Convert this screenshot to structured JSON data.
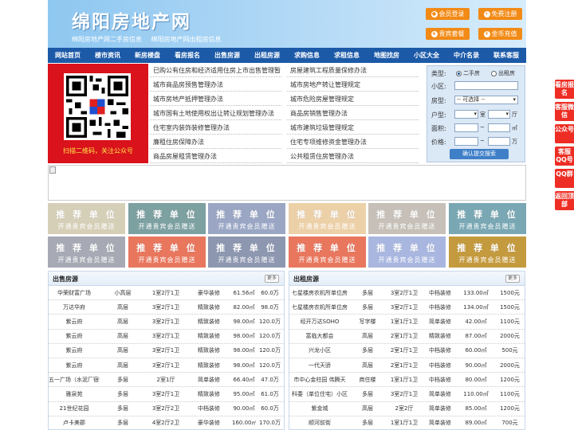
{
  "header": {
    "logo": "绵阳房地产网",
    "sub_links": [
      "绵阳房地产网二手房信息",
      "绵阳房地产网出租房信息"
    ],
    "buttons": [
      {
        "label": "会员登录",
        "icon": "user-icon"
      },
      {
        "label": "免费注册",
        "icon": "register-icon"
      },
      {
        "label": "贵宾套餐",
        "icon": "vip-icon"
      },
      {
        "label": "金币充值",
        "icon": "coin-icon"
      }
    ]
  },
  "nav": [
    "网站首页",
    "楼市资讯",
    "新房楼盘",
    "看房报名",
    "出售房源",
    "出租房源",
    "求购信息",
    "求租信息",
    "地图找房",
    "小区大全",
    "中介名录",
    "联系客服"
  ],
  "qr": {
    "caption": "扫描二维码，关注公众号"
  },
  "policy": {
    "left": [
      "已购公有住房和经济适用住房上市出售管理暂",
      "城市商品房预售管理办法",
      "城市房地产抵押管理办法",
      "城市国有土地使用权出让转让规划管理办法",
      "住宅室内装饰装修管理办法",
      "廉租住房保障办法",
      "商品房屋租赁管理办法"
    ],
    "right": [
      "房屋建筑工程质量保修办法",
      "城市房地产转让管理规定",
      "城市危险房屋管理规定",
      "商品房销售管理办法",
      "城市建筑垃圾管理规定",
      "住宅专项维修资金管理办法",
      "公共租赁住房管理办法"
    ]
  },
  "search": {
    "type_label": "类型:",
    "type_options": [
      "二手房",
      "出租房"
    ],
    "community_label": "小区:",
    "room_label": "房型:",
    "room_select": "-- 可选择 --",
    "layout_label": "户型:",
    "layout_units": [
      "室",
      "厅"
    ],
    "area_label": "面积:",
    "area_unit": "㎡",
    "price_label": "价格:",
    "price_unit": "万",
    "range_sep": "~",
    "submit": "确认提交搜索"
  },
  "ads": {
    "line1": "推 荐 单 位",
    "line2": "开通贵宾会员赠送",
    "colors": [
      "#d6cfb8",
      "#7da0a1",
      "#9aa6c4",
      "#ecd0a8",
      "#c6c0b8",
      "#79a7b3",
      "#a7aab4",
      "#e8775e",
      "#8d97b0",
      "#e8775e",
      "#a9b7e0",
      "#c49a3f"
    ]
  },
  "sale": {
    "title": "出售房源",
    "more": "更多",
    "rows": [
      [
        "华荣财富广场",
        "小高层",
        "1室2厅1卫",
        "豪华装修",
        "61.56㎡",
        "60.0万"
      ],
      [
        "万达华府",
        "高层",
        "3室2厅1卫",
        "精致装修",
        "82.00㎡",
        "98.0万"
      ],
      [
        "紫云府",
        "高层",
        "3室2厅1卫",
        "精致装修",
        "98.00㎡",
        "120.0万"
      ],
      [
        "紫云府",
        "高层",
        "3室2厅1卫",
        "精致装修",
        "98.00㎡",
        "120.0万"
      ],
      [
        "紫云府",
        "高层",
        "3室2厅1卫",
        "精致装修",
        "98.00㎡",
        "120.0万"
      ],
      [
        "紫云府",
        "高层",
        "3室2厅1卫",
        "精致装修",
        "98.00㎡",
        "120.0万"
      ],
      [
        "五一广场（水泥厂宿舍",
        "多层",
        "2室1厅",
        "简单装修",
        "66.40㎡",
        "47.0万"
      ],
      [
        "雅泉苑",
        "多层",
        "3室2厅1卫",
        "精致装修",
        "95.00㎡",
        "61.0万"
      ],
      [
        "21世纪花园",
        "多层",
        "3室2厅2卫",
        "中档装修",
        "90.00㎡",
        "60.0万"
      ],
      [
        "卢卡美郡",
        "多层",
        "4室2厅2卫",
        "豪华装修",
        "160.00㎡",
        "170.0万"
      ]
    ]
  },
  "rent": {
    "title": "出租房源",
    "more": "更多",
    "rows": [
      [
        "七星楼房农机所单位房",
        "多层",
        "3室2厅1卫",
        "中档装修",
        "133.00㎡",
        "1500元"
      ],
      [
        "七星楼房农机所单位房",
        "多层",
        "3室2厅1卫",
        "中档装修",
        "134.00㎡",
        "1500元"
      ],
      [
        "经开万达SOHO",
        "写字楼",
        "1室1厅1卫",
        "简单装修",
        "42.00㎡",
        "1100元"
      ],
      [
        "富临大都会",
        "高层",
        "2室1厅1卫",
        "精致装修",
        "87.00㎡",
        "2000元"
      ],
      [
        "兴龙小区",
        "多层",
        "2室1厅1卫",
        "中档装修",
        "60.00㎡",
        "500元"
      ],
      [
        "一代天骄",
        "高层",
        "2室1厅1卫",
        "中档装修",
        "90.00㎡",
        "2000元"
      ],
      [
        "市中心金柱园 伟腾天",
        "商住楼",
        "1室1厅1卫",
        "中档装修",
        "80.00㎡",
        "1200元"
      ],
      [
        "科委（单位住宅）小区",
        "多层",
        "3室2厅1卫",
        "简单装修",
        "110.00㎡",
        "1100元"
      ],
      [
        "紫金城",
        "高层",
        "2室2厅",
        "简单装修",
        "85.00㎡",
        "1200元"
      ],
      [
        "顺河前街",
        "多层",
        "1室1厅1卫",
        "简单装修",
        "89.00㎡",
        "700元"
      ]
    ]
  },
  "float": [
    "看房报名",
    "客服微信",
    "公众号",
    "客服QQ号",
    "QQ群",
    "返回顶部"
  ]
}
